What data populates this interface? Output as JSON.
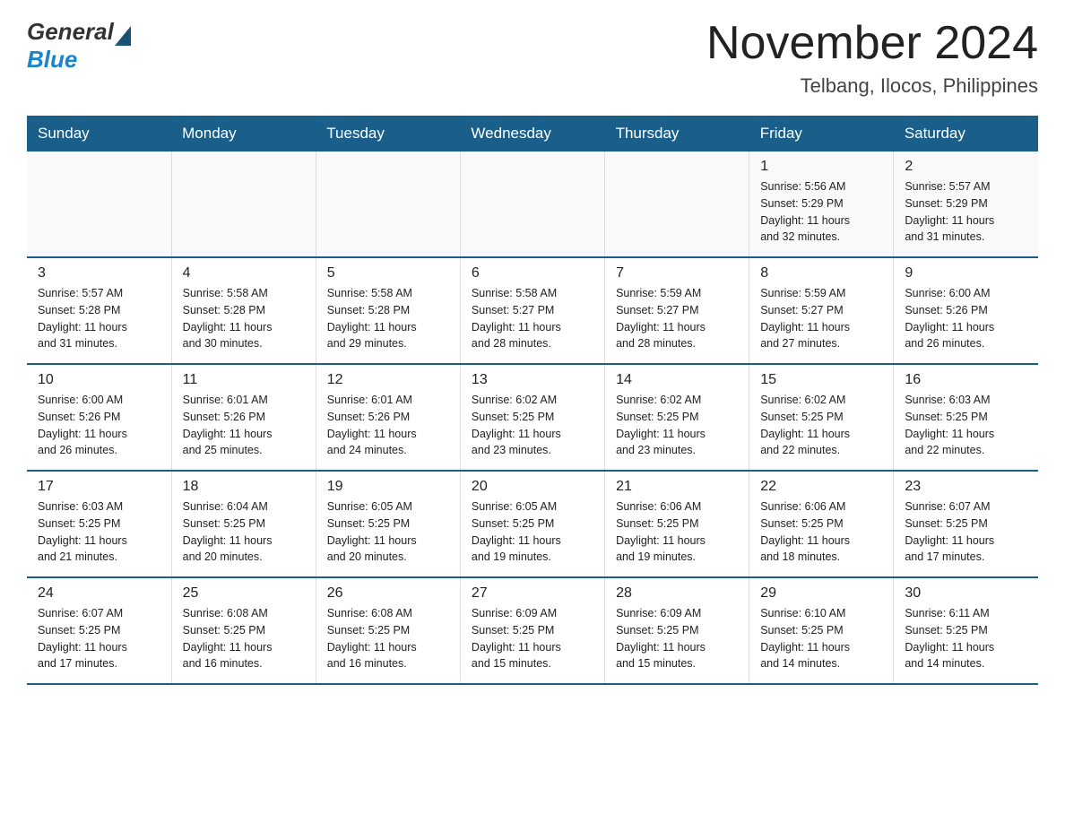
{
  "header": {
    "logo_general": "General",
    "logo_blue": "Blue",
    "month_title": "November 2024",
    "location": "Telbang, Ilocos, Philippines"
  },
  "days_of_week": [
    "Sunday",
    "Monday",
    "Tuesday",
    "Wednesday",
    "Thursday",
    "Friday",
    "Saturday"
  ],
  "weeks": [
    {
      "days": [
        {
          "number": "",
          "info": ""
        },
        {
          "number": "",
          "info": ""
        },
        {
          "number": "",
          "info": ""
        },
        {
          "number": "",
          "info": ""
        },
        {
          "number": "",
          "info": ""
        },
        {
          "number": "1",
          "info": "Sunrise: 5:56 AM\nSunset: 5:29 PM\nDaylight: 11 hours\nand 32 minutes."
        },
        {
          "number": "2",
          "info": "Sunrise: 5:57 AM\nSunset: 5:29 PM\nDaylight: 11 hours\nand 31 minutes."
        }
      ]
    },
    {
      "days": [
        {
          "number": "3",
          "info": "Sunrise: 5:57 AM\nSunset: 5:28 PM\nDaylight: 11 hours\nand 31 minutes."
        },
        {
          "number": "4",
          "info": "Sunrise: 5:58 AM\nSunset: 5:28 PM\nDaylight: 11 hours\nand 30 minutes."
        },
        {
          "number": "5",
          "info": "Sunrise: 5:58 AM\nSunset: 5:28 PM\nDaylight: 11 hours\nand 29 minutes."
        },
        {
          "number": "6",
          "info": "Sunrise: 5:58 AM\nSunset: 5:27 PM\nDaylight: 11 hours\nand 28 minutes."
        },
        {
          "number": "7",
          "info": "Sunrise: 5:59 AM\nSunset: 5:27 PM\nDaylight: 11 hours\nand 28 minutes."
        },
        {
          "number": "8",
          "info": "Sunrise: 5:59 AM\nSunset: 5:27 PM\nDaylight: 11 hours\nand 27 minutes."
        },
        {
          "number": "9",
          "info": "Sunrise: 6:00 AM\nSunset: 5:26 PM\nDaylight: 11 hours\nand 26 minutes."
        }
      ]
    },
    {
      "days": [
        {
          "number": "10",
          "info": "Sunrise: 6:00 AM\nSunset: 5:26 PM\nDaylight: 11 hours\nand 26 minutes."
        },
        {
          "number": "11",
          "info": "Sunrise: 6:01 AM\nSunset: 5:26 PM\nDaylight: 11 hours\nand 25 minutes."
        },
        {
          "number": "12",
          "info": "Sunrise: 6:01 AM\nSunset: 5:26 PM\nDaylight: 11 hours\nand 24 minutes."
        },
        {
          "number": "13",
          "info": "Sunrise: 6:02 AM\nSunset: 5:25 PM\nDaylight: 11 hours\nand 23 minutes."
        },
        {
          "number": "14",
          "info": "Sunrise: 6:02 AM\nSunset: 5:25 PM\nDaylight: 11 hours\nand 23 minutes."
        },
        {
          "number": "15",
          "info": "Sunrise: 6:02 AM\nSunset: 5:25 PM\nDaylight: 11 hours\nand 22 minutes."
        },
        {
          "number": "16",
          "info": "Sunrise: 6:03 AM\nSunset: 5:25 PM\nDaylight: 11 hours\nand 22 minutes."
        }
      ]
    },
    {
      "days": [
        {
          "number": "17",
          "info": "Sunrise: 6:03 AM\nSunset: 5:25 PM\nDaylight: 11 hours\nand 21 minutes."
        },
        {
          "number": "18",
          "info": "Sunrise: 6:04 AM\nSunset: 5:25 PM\nDaylight: 11 hours\nand 20 minutes."
        },
        {
          "number": "19",
          "info": "Sunrise: 6:05 AM\nSunset: 5:25 PM\nDaylight: 11 hours\nand 20 minutes."
        },
        {
          "number": "20",
          "info": "Sunrise: 6:05 AM\nSunset: 5:25 PM\nDaylight: 11 hours\nand 19 minutes."
        },
        {
          "number": "21",
          "info": "Sunrise: 6:06 AM\nSunset: 5:25 PM\nDaylight: 11 hours\nand 19 minutes."
        },
        {
          "number": "22",
          "info": "Sunrise: 6:06 AM\nSunset: 5:25 PM\nDaylight: 11 hours\nand 18 minutes."
        },
        {
          "number": "23",
          "info": "Sunrise: 6:07 AM\nSunset: 5:25 PM\nDaylight: 11 hours\nand 17 minutes."
        }
      ]
    },
    {
      "days": [
        {
          "number": "24",
          "info": "Sunrise: 6:07 AM\nSunset: 5:25 PM\nDaylight: 11 hours\nand 17 minutes."
        },
        {
          "number": "25",
          "info": "Sunrise: 6:08 AM\nSunset: 5:25 PM\nDaylight: 11 hours\nand 16 minutes."
        },
        {
          "number": "26",
          "info": "Sunrise: 6:08 AM\nSunset: 5:25 PM\nDaylight: 11 hours\nand 16 minutes."
        },
        {
          "number": "27",
          "info": "Sunrise: 6:09 AM\nSunset: 5:25 PM\nDaylight: 11 hours\nand 15 minutes."
        },
        {
          "number": "28",
          "info": "Sunrise: 6:09 AM\nSunset: 5:25 PM\nDaylight: 11 hours\nand 15 minutes."
        },
        {
          "number": "29",
          "info": "Sunrise: 6:10 AM\nSunset: 5:25 PM\nDaylight: 11 hours\nand 14 minutes."
        },
        {
          "number": "30",
          "info": "Sunrise: 6:11 AM\nSunset: 5:25 PM\nDaylight: 11 hours\nand 14 minutes."
        }
      ]
    }
  ]
}
